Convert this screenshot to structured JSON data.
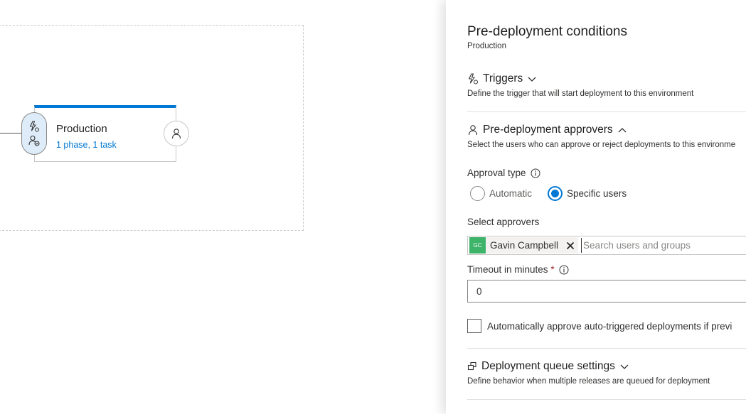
{
  "canvas": {
    "environment": {
      "name": "Production",
      "summary": "1 phase, 1 task"
    }
  },
  "panel": {
    "title": "Pre-deployment conditions",
    "subtitle": "Production",
    "triggers": {
      "title": "Triggers",
      "description": "Define the trigger that will start deployment to this environment"
    },
    "approvers": {
      "title": "Pre-deployment approvers",
      "description": "Select the users who can approve or reject deployments to this environme",
      "approval_type_label": "Approval type",
      "options": [
        "Automatic",
        "Specific users"
      ],
      "selected_option": "Specific users",
      "select_approvers_label": "Select approvers",
      "approver": {
        "initials": "GC",
        "name": "Gavin Campbell"
      },
      "search_placeholder": "Search users and groups",
      "timeout_label": "Timeout in minutes",
      "timeout_required_marker": "*",
      "timeout_value": "0",
      "auto_approve_label": "Automatically approve auto-triggered deployments if previ"
    },
    "queue": {
      "title": "Deployment queue settings",
      "description": "Define behavior when multiple releases are queued for deployment"
    }
  },
  "colors": {
    "accent": "#0078d4",
    "avatar": "#3eb36a",
    "required": "#a4262c"
  }
}
